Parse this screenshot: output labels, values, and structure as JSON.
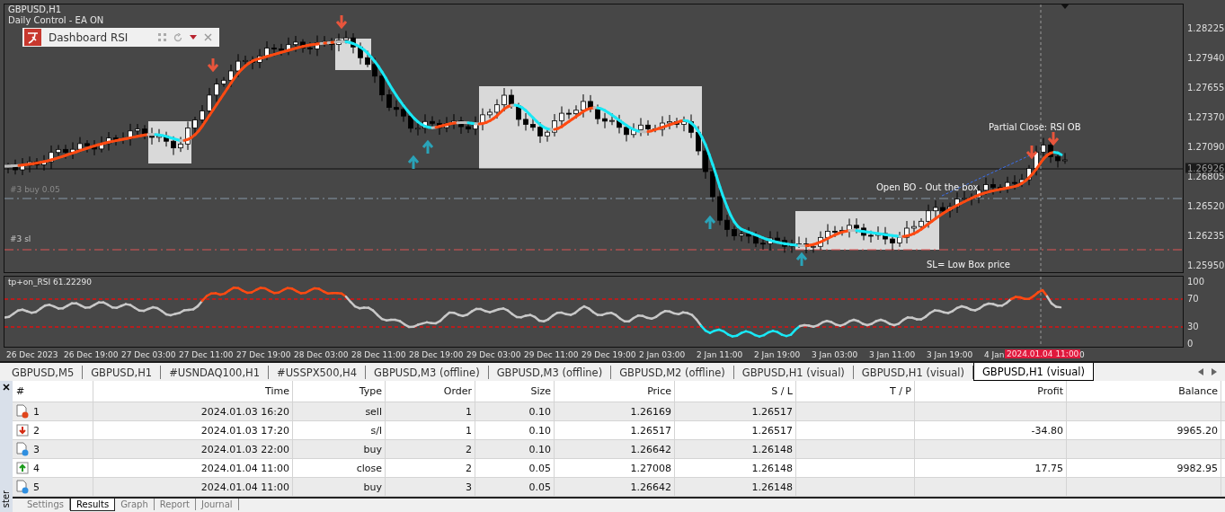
{
  "chart": {
    "symbol": "GBPUSD,H1",
    "subtitle": "Daily Control - EA ON",
    "dashboard": {
      "title": "Dashboard RSI"
    },
    "annotations": [
      {
        "kind": "partial",
        "text": "Partial Close: RSI OB"
      },
      {
        "kind": "open",
        "text": "Open BO - Out the box"
      },
      {
        "kind": "sl",
        "text": "SL= Low Box price"
      }
    ],
    "order_lines": [
      {
        "kind": "buy",
        "text": "#3 buy 0.05"
      },
      {
        "kind": "sl",
        "text": "#3 sl"
      }
    ],
    "price_axis": [
      "1.28225",
      "1.27940",
      "1.27655",
      "1.27370",
      "1.27090",
      "1.26805",
      "1.26520",
      "1.26235",
      "1.25950"
    ],
    "current_price": "1.26926",
    "indicator": {
      "title": "tp+on_RSI 61.22290",
      "levels": [
        "100",
        "70",
        "30",
        "0"
      ]
    },
    "time_axis": [
      "26 Dec 2023",
      "26 Dec 19:00",
      "27 Dec 03:00",
      "27 Dec 11:00",
      "27 Dec 19:00",
      "28 Dec 03:00",
      "28 Dec 11:00",
      "28 Dec 19:00",
      "29 Dec 03:00",
      "29 Dec 11:00",
      "29 Dec 19:00",
      "2 Jan 03:00",
      "2 Jan 11:00",
      "2 Jan 19:00",
      "3 Jan 03:00",
      "3 Jan 11:00",
      "3 Jan 19:00",
      "4 Jan"
    ],
    "cursor_time": "2024.01.04 11:00",
    "time_tail": "0"
  },
  "tabs": [
    {
      "label": "GBPUSD,M5",
      "selected": false
    },
    {
      "label": "GBPUSD,H1",
      "selected": false
    },
    {
      "label": "#USNDAQ100,H1",
      "selected": false
    },
    {
      "label": "#USSPX500,H4",
      "selected": false
    },
    {
      "label": "GBPUSD,M3 (offline)",
      "selected": false
    },
    {
      "label": "GBPUSD,M3 (offline)",
      "selected": false
    },
    {
      "label": "GBPUSD,M2 (offline)",
      "selected": false
    },
    {
      "label": "GBPUSD,H1 (visual)",
      "selected": false
    },
    {
      "label": "GBPUSD,H1 (visual)",
      "selected": false
    },
    {
      "label": "GBPUSD,H1 (visual)",
      "selected": true
    }
  ],
  "table": {
    "columns": [
      "#",
      "Time",
      "Type",
      "Order",
      "Size",
      "Price",
      "S / L",
      "T / P",
      "Profit",
      "Balance"
    ],
    "rows": [
      {
        "kind": "sell",
        "cells": [
          "1",
          "2024.01.03 16:20",
          "sell",
          "1",
          "0.10",
          "1.26169",
          "1.26517"
        ]
      },
      {
        "kind": "stop",
        "cells": [
          "2",
          "2024.01.03 17:20",
          "s/l",
          "1",
          "0.10",
          "1.26517",
          "1.26517",
          "",
          "-34.80",
          "9965.20"
        ]
      },
      {
        "kind": "buy",
        "cells": [
          "3",
          "2024.01.03 22:00",
          "buy",
          "2",
          "0.10",
          "1.26642",
          "1.26148"
        ]
      },
      {
        "kind": "close",
        "cells": [
          "4",
          "2024.01.04 11:00",
          "close",
          "2",
          "0.05",
          "1.27008",
          "1.26148",
          "",
          "17.75",
          "9982.95"
        ]
      },
      {
        "kind": "buy",
        "cells": [
          "5",
          "2024.01.04 11:00",
          "buy",
          "3",
          "0.05",
          "1.26642",
          "1.26148"
        ]
      }
    ]
  },
  "side_panel": {
    "label": "ster"
  },
  "bottom_tabs": [
    {
      "label": "Settings",
      "selected": false
    },
    {
      "label": "Results",
      "selected": true
    },
    {
      "label": "Graph",
      "selected": false
    },
    {
      "label": "Report",
      "selected": false
    },
    {
      "label": "Journal",
      "selected": false
    }
  ]
}
